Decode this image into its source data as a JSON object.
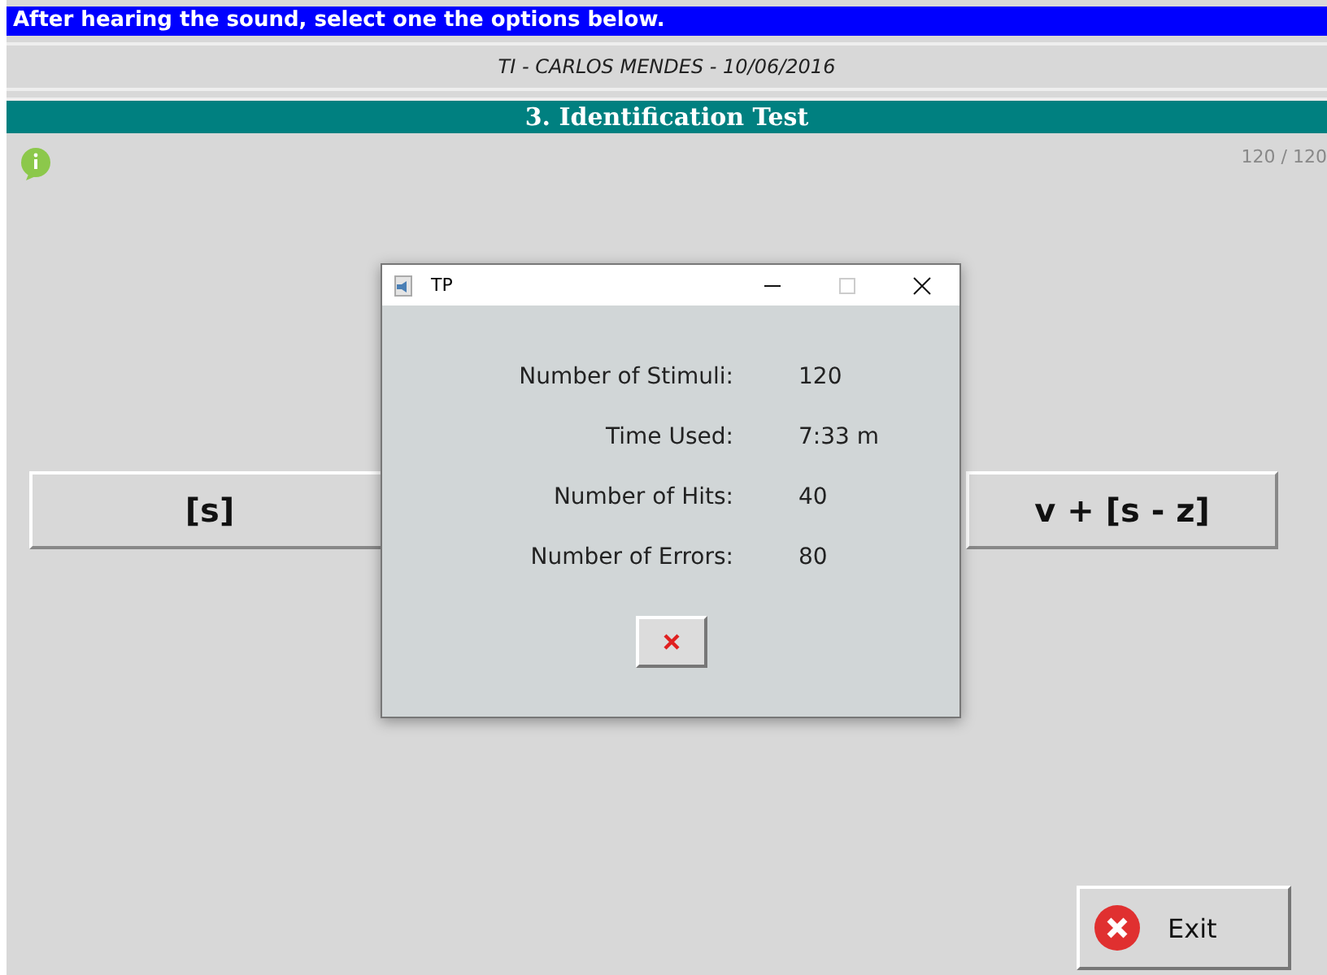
{
  "instruction": "After hearing the sound, select one the options below.",
  "session": "TI - CARLOS MENDES - 10/06/2016",
  "test_title": "3. Identification Test",
  "progress": "120 / 120",
  "options": [
    "[s]",
    "v + [s - z]"
  ],
  "dialog": {
    "title": "TP",
    "stats": [
      {
        "label": "Number of Stimuli:",
        "value": "120"
      },
      {
        "label": "Time Used:",
        "value": "7:33 m"
      },
      {
        "label": "Number of Hits:",
        "value": "40"
      },
      {
        "label": "Number of Errors:",
        "value": "80"
      }
    ]
  },
  "exit_button": "Exit"
}
